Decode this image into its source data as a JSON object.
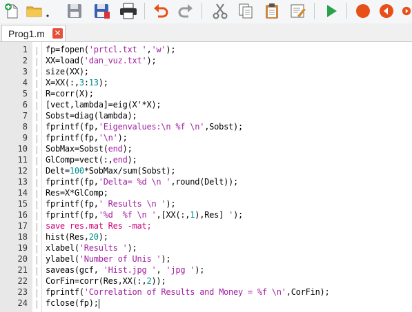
{
  "colors": {
    "accent_green": "#2aa14b",
    "record_red": "#e8501a",
    "tab_close_red": "#e5503a",
    "string_color": "#a020a0",
    "number_color": "#008c8c"
  },
  "toolbar": {
    "buttons": [
      {
        "name": "new-file-button",
        "icon": "new-file-icon"
      },
      {
        "name": "open-folder-button",
        "icon": "folder-icon"
      },
      {
        "name": "save-button",
        "icon": "save-icon"
      },
      {
        "name": "save-all-button",
        "icon": "save-all-icon"
      },
      {
        "name": "print-button",
        "icon": "printer-icon"
      },
      {
        "name": "undo-button",
        "icon": "undo-icon"
      },
      {
        "name": "redo-button",
        "icon": "redo-icon"
      },
      {
        "name": "cut-button",
        "icon": "scissors-icon"
      },
      {
        "name": "copy-button",
        "icon": "copy-icon"
      },
      {
        "name": "paste-button",
        "icon": "clipboard-icon"
      },
      {
        "name": "edit-button",
        "icon": "edit-icon"
      },
      {
        "name": "run-button",
        "icon": "play-icon"
      },
      {
        "name": "record-button",
        "icon": "record-icon"
      },
      {
        "name": "back-button",
        "icon": "back-icon"
      },
      {
        "name": "forward-button",
        "icon": "forward-icon"
      }
    ]
  },
  "tabs": [
    {
      "label": "Prog1.m",
      "close": "✕"
    }
  ],
  "editor": {
    "lines": [
      {
        "n": "1",
        "tokens": [
          {
            "t": "fp=fopen(",
            "c": "plain"
          },
          {
            "t": "'prtcl.txt '",
            "c": "str"
          },
          {
            "t": ",",
            "c": "plain"
          },
          {
            "t": "'w'",
            "c": "str"
          },
          {
            "t": ");",
            "c": "plain"
          }
        ]
      },
      {
        "n": "2",
        "tokens": [
          {
            "t": "XX=load(",
            "c": "plain"
          },
          {
            "t": "'dan_vuz.txt'",
            "c": "str"
          },
          {
            "t": ");",
            "c": "plain"
          }
        ]
      },
      {
        "n": "3",
        "tokens": [
          {
            "t": "size(XX);",
            "c": "plain"
          }
        ]
      },
      {
        "n": "4",
        "tokens": [
          {
            "t": "X=XX(:,",
            "c": "plain"
          },
          {
            "t": "3",
            "c": "num"
          },
          {
            "t": ":",
            "c": "plain"
          },
          {
            "t": "13",
            "c": "num"
          },
          {
            "t": ");",
            "c": "plain"
          }
        ]
      },
      {
        "n": "5",
        "tokens": [
          {
            "t": "R=corr(X);",
            "c": "plain"
          }
        ]
      },
      {
        "n": "6",
        "tokens": [
          {
            "t": "[vect,lambda]=eig(X'*X);",
            "c": "plain"
          }
        ]
      },
      {
        "n": "7",
        "tokens": [
          {
            "t": "Sobst=diag(lambda);",
            "c": "plain"
          }
        ]
      },
      {
        "n": "8",
        "tokens": [
          {
            "t": "fprintf(fp,",
            "c": "plain"
          },
          {
            "t": "'Eigenvalues:\\n %f \\n'",
            "c": "str"
          },
          {
            "t": ",Sobst);",
            "c": "plain"
          }
        ]
      },
      {
        "n": "9",
        "tokens": [
          {
            "t": "fprintf(fp,",
            "c": "plain"
          },
          {
            "t": "'\\n'",
            "c": "str"
          },
          {
            "t": ");",
            "c": "plain"
          }
        ]
      },
      {
        "n": "10",
        "tokens": [
          {
            "t": "SobMax=Sobst(",
            "c": "plain"
          },
          {
            "t": "end",
            "c": "kw"
          },
          {
            "t": ");",
            "c": "plain"
          }
        ]
      },
      {
        "n": "11",
        "tokens": [
          {
            "t": "GlComp=vect(:,",
            "c": "plain"
          },
          {
            "t": "end",
            "c": "kw"
          },
          {
            "t": ");",
            "c": "plain"
          }
        ]
      },
      {
        "n": "12",
        "tokens": [
          {
            "t": "Delt=",
            "c": "plain"
          },
          {
            "t": "100",
            "c": "num"
          },
          {
            "t": "*SobMax/sum(Sobst);",
            "c": "plain"
          }
        ]
      },
      {
        "n": "13",
        "tokens": [
          {
            "t": "fprintf(fp,",
            "c": "plain"
          },
          {
            "t": "'Delta= %d \\n '",
            "c": "str"
          },
          {
            "t": ",round(Delt));",
            "c": "plain"
          }
        ]
      },
      {
        "n": "14",
        "tokens": [
          {
            "t": "Res=X*GlComp;",
            "c": "plain"
          }
        ]
      },
      {
        "n": "15",
        "tokens": [
          {
            "t": "fprintf(fp,",
            "c": "plain"
          },
          {
            "t": "' Results \\n '",
            "c": "str"
          },
          {
            "t": ");",
            "c": "plain"
          }
        ]
      },
      {
        "n": "16",
        "tokens": [
          {
            "t": "fprintf(fp,",
            "c": "plain"
          },
          {
            "t": "'%d  %f \\n '",
            "c": "str"
          },
          {
            "t": ",[XX(:,",
            "c": "plain"
          },
          {
            "t": "1",
            "c": "num"
          },
          {
            "t": "),Res] ",
            "c": "plain"
          },
          {
            "t": "'",
            "c": "str"
          },
          {
            "t": ");",
            "c": "plain"
          }
        ]
      },
      {
        "n": "17",
        "tokens": [
          {
            "t": "save res.mat Res -mat;",
            "c": "pink"
          }
        ]
      },
      {
        "n": "18",
        "tokens": [
          {
            "t": "hist(Res,",
            "c": "plain"
          },
          {
            "t": "20",
            "c": "num"
          },
          {
            "t": ");",
            "c": "plain"
          }
        ]
      },
      {
        "n": "19",
        "tokens": [
          {
            "t": "xlabel(",
            "c": "plain"
          },
          {
            "t": "'Results '",
            "c": "str"
          },
          {
            "t": ");",
            "c": "plain"
          }
        ]
      },
      {
        "n": "20",
        "tokens": [
          {
            "t": "ylabel(",
            "c": "plain"
          },
          {
            "t": "'Number of Unis '",
            "c": "str"
          },
          {
            "t": ");",
            "c": "plain"
          }
        ]
      },
      {
        "n": "21",
        "tokens": [
          {
            "t": "saveas(gcf, ",
            "c": "plain"
          },
          {
            "t": "'Hist.jpg '",
            "c": "str"
          },
          {
            "t": ", ",
            "c": "plain"
          },
          {
            "t": "'jpg '",
            "c": "str"
          },
          {
            "t": ");",
            "c": "plain"
          }
        ]
      },
      {
        "n": "22",
        "tokens": [
          {
            "t": "CorFin=corr(Res,XX(:,",
            "c": "plain"
          },
          {
            "t": "2",
            "c": "num"
          },
          {
            "t": "));",
            "c": "plain"
          }
        ]
      },
      {
        "n": "23",
        "tokens": [
          {
            "t": "fprintf(",
            "c": "plain"
          },
          {
            "t": "'Correlation of Results and Money = %f \\n'",
            "c": "str"
          },
          {
            "t": ",CorFin);",
            "c": "plain"
          }
        ]
      },
      {
        "n": "24",
        "tokens": [
          {
            "t": "fclose(fp);",
            "c": "plain"
          }
        ]
      }
    ]
  }
}
